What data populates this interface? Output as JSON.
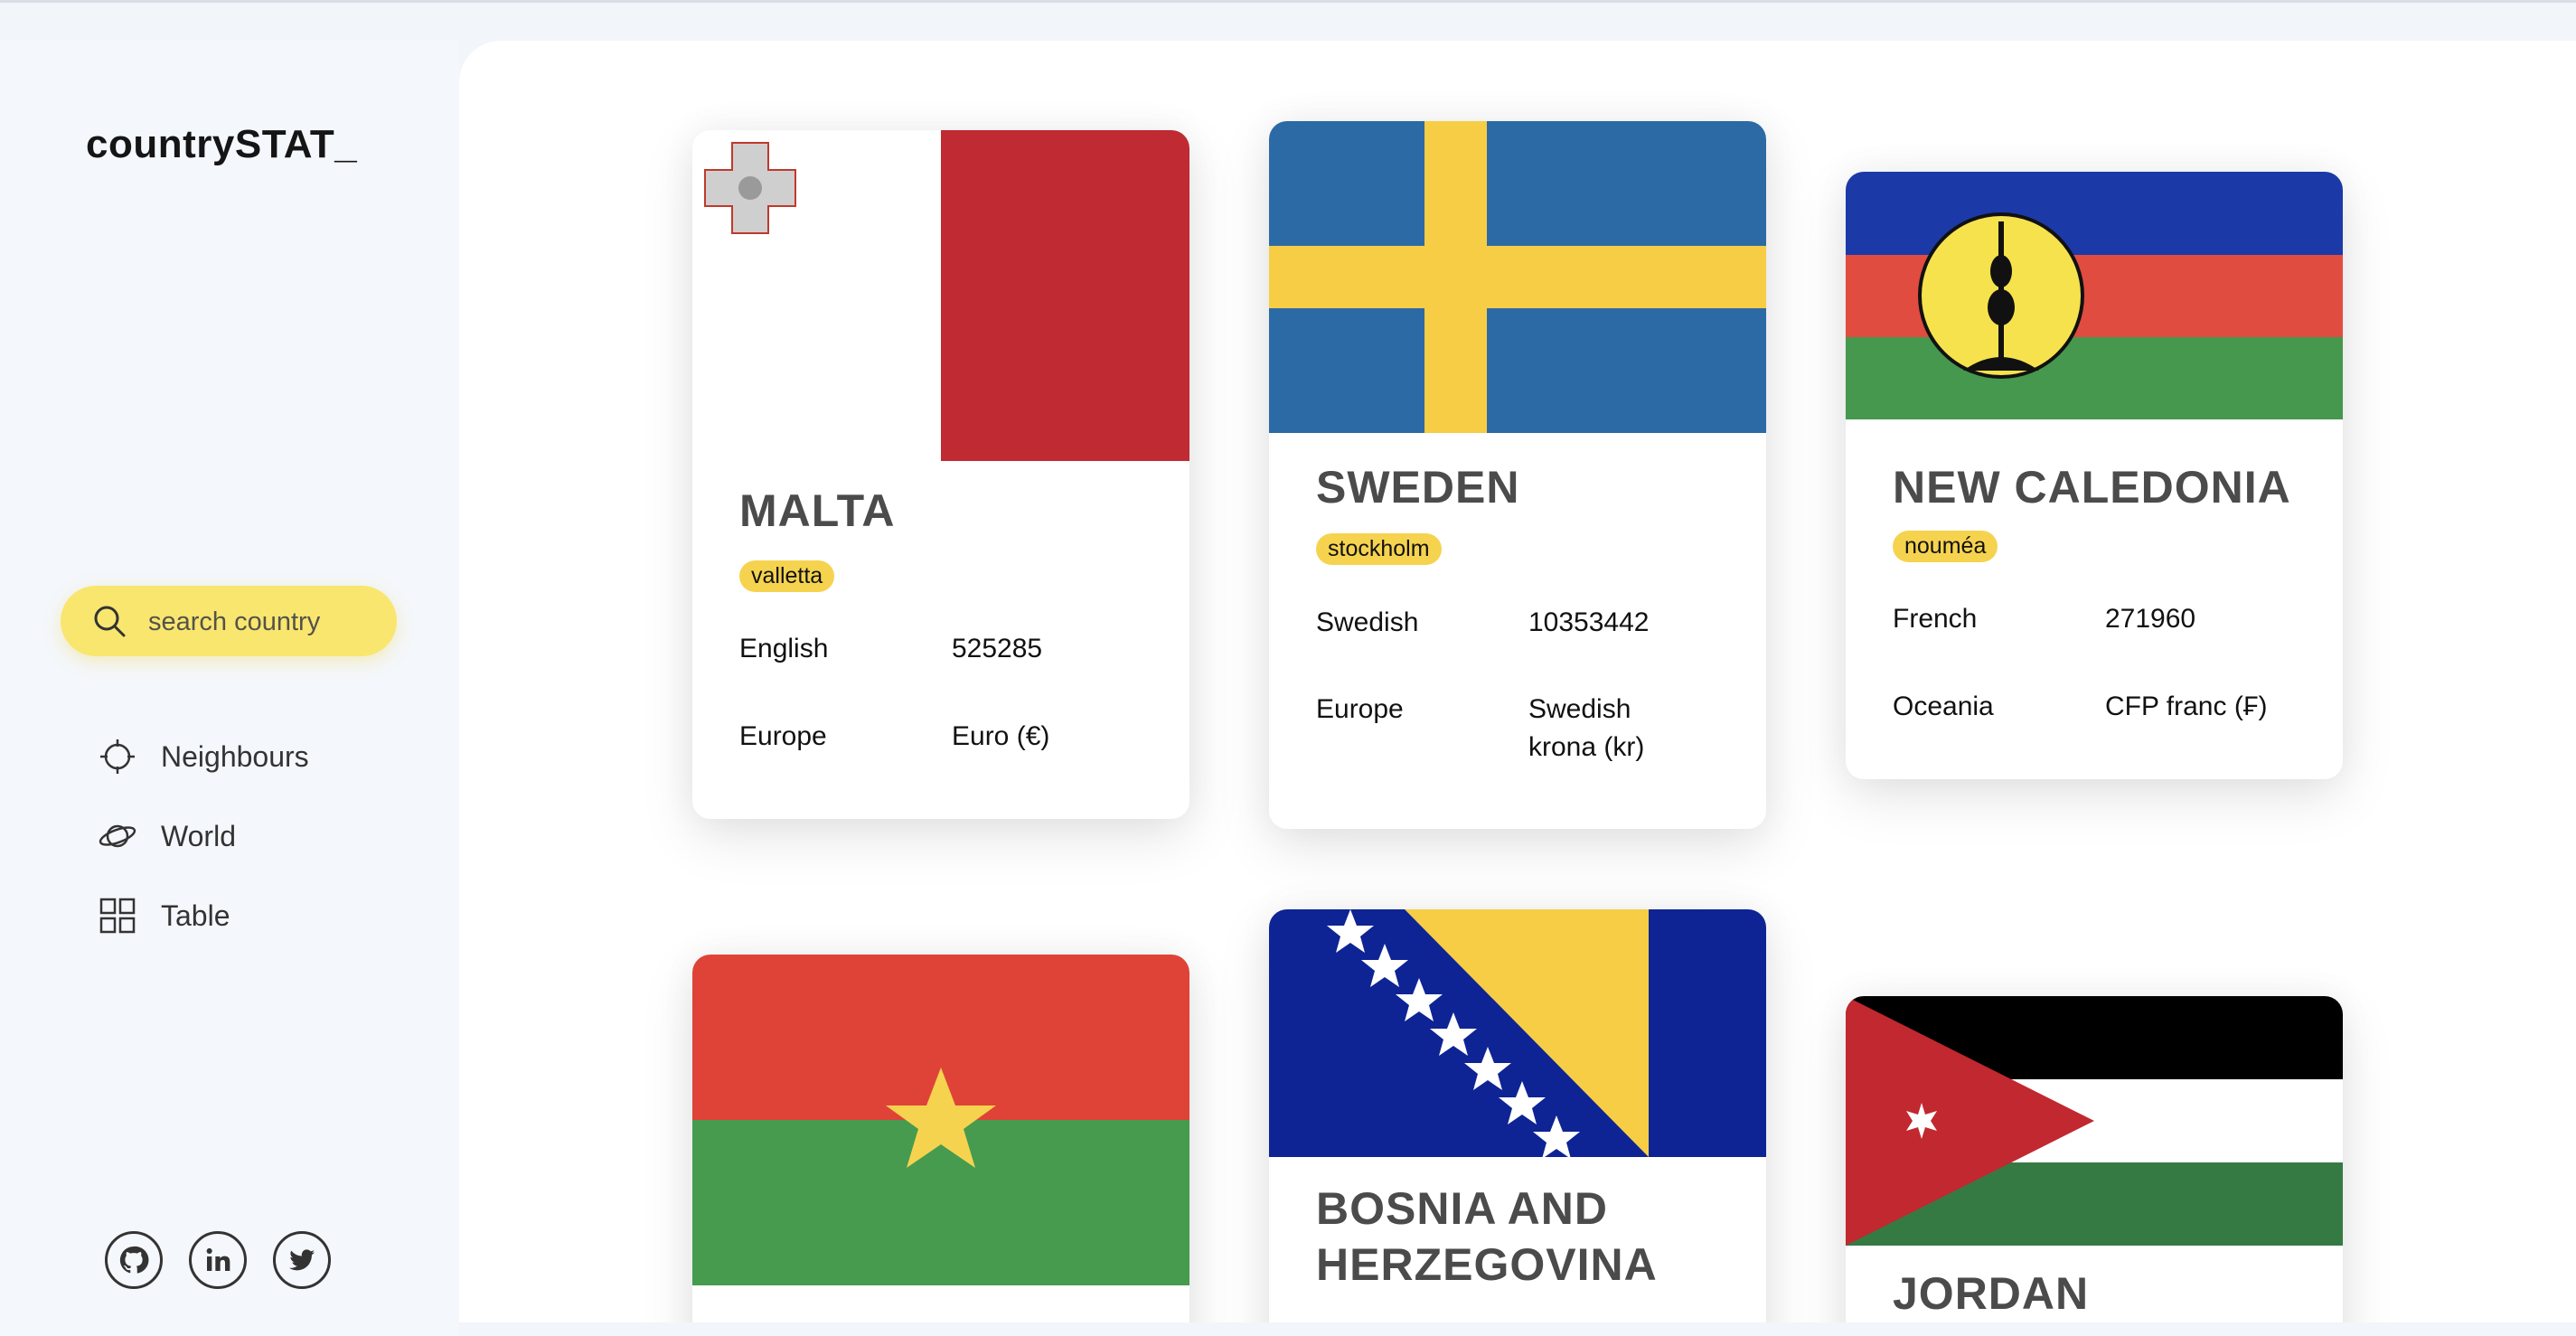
{
  "app": {
    "logo": "countrySTAT_"
  },
  "search": {
    "placeholder": "search country",
    "value": ""
  },
  "nav": [
    {
      "label": "Neighbours",
      "icon": "crosshair-icon"
    },
    {
      "label": "World",
      "icon": "planet-icon"
    },
    {
      "label": "Table",
      "icon": "grid-icon"
    }
  ],
  "social": [
    {
      "icon": "github-icon"
    },
    {
      "icon": "linkedin-icon"
    },
    {
      "icon": "twitter-icon"
    }
  ],
  "cards": [
    {
      "name": "MALTA",
      "capital": "valletta",
      "language": "English",
      "population": "525285",
      "region": "Europe",
      "currency": "Euro (€)",
      "flag": "malta-flag"
    },
    {
      "name": "SWEDEN",
      "capital": "stockholm",
      "language": "Swedish",
      "population": "10353442",
      "region": "Europe",
      "currency": "Swedish krona (kr)",
      "flag": "sweden-flag"
    },
    {
      "name": "NEW CALEDONIA",
      "capital": "nouméa",
      "language": "French",
      "population": "271960",
      "region": "Oceania",
      "currency": "CFP franc (₣)",
      "flag": "new-caledonia-flag"
    },
    {
      "name": "",
      "flag": "burkina-faso-flag"
    },
    {
      "name": "BOSNIA AND HERZEGOVINA",
      "flag": "bosnia-flag"
    },
    {
      "name": "JORDAN",
      "flag": "jordan-flag"
    }
  ],
  "colors": {
    "accent": "#f8e66f",
    "capital_badge": "#f6d34f",
    "sidebar_bg": "#f4f7fb"
  }
}
